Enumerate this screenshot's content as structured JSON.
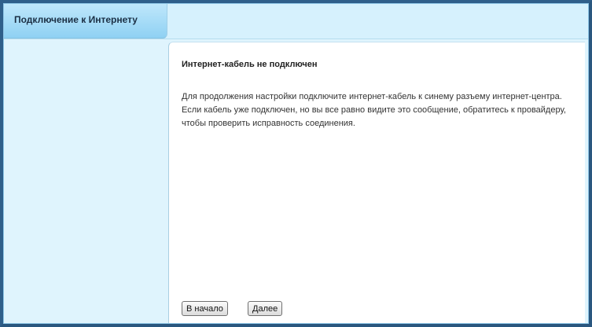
{
  "header": {
    "title": "Подключение к Интернету"
  },
  "content": {
    "title": "Интернет-кабель не подключен",
    "message": "Для продолжения настройки подключите интернет-кабель к синему разъему интернет-центра. Если кабель уже подключен, но вы все равно видите это сообщение, обратитесь к провайдеру, чтобы проверить исправность соединения."
  },
  "buttons": {
    "home_label": "В начало",
    "next_label": "Далее"
  },
  "colors": {
    "frame_border": "#2f5f8a",
    "background": "#dff4fd",
    "tab_gradient_top": "#bfe7fb",
    "tab_gradient_bottom": "#8fd1f3",
    "panel": "#ffffff"
  }
}
